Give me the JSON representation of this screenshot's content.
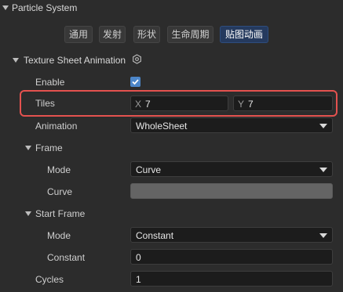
{
  "header": {
    "title": "Particle System"
  },
  "tabs": [
    {
      "label": "通用",
      "active": false
    },
    {
      "label": "发射",
      "active": false
    },
    {
      "label": "形状",
      "active": false
    },
    {
      "label": "生命周期",
      "active": false
    },
    {
      "label": "贴图动画",
      "active": true
    }
  ],
  "section": {
    "title": "Texture Sheet Animation",
    "icon": "settings-icon"
  },
  "enable": {
    "label": "Enable",
    "checked": true,
    "icon": "checkmark-icon"
  },
  "tiles": {
    "label": "Tiles",
    "x_prefix": "X",
    "x_value": "7",
    "y_prefix": "Y",
    "y_value": "7",
    "highlight_color": "#e4524f"
  },
  "animation": {
    "label": "Animation",
    "value": "WholeSheet"
  },
  "frame": {
    "title": "Frame",
    "mode_label": "Mode",
    "mode_value": "Curve",
    "curve_label": "Curve"
  },
  "start_frame": {
    "title": "Start Frame",
    "mode_label": "Mode",
    "mode_value": "Constant",
    "constant_label": "Constant",
    "constant_value": "0"
  },
  "cycles": {
    "label": "Cycles",
    "value": "1"
  },
  "colors": {
    "background": "#2c2c2c",
    "field": "#1c1c1c",
    "accent": "#4c86c9",
    "active_tab": "#253a5e",
    "curve_swatch": "#646464"
  }
}
